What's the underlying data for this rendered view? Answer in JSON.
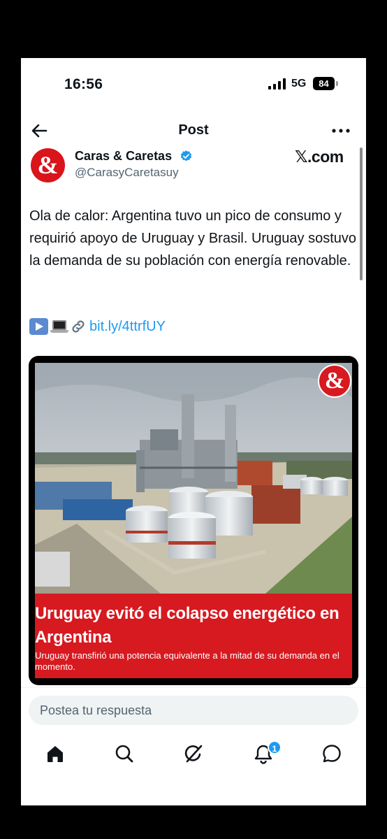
{
  "status_bar": {
    "time": "16:56",
    "network": "5G",
    "battery": "84"
  },
  "header": {
    "title": "Post",
    "back_icon": "arrow-left-icon",
    "more_icon": "more-horizontal-icon"
  },
  "author": {
    "name": "Caras & Caretas",
    "handle": "@CarasyCaretasuy",
    "avatar_text": "&",
    "verified": true
  },
  "watermark": "𝕏.com",
  "tweet": {
    "text": "Ola de calor: Argentina tuvo un pico de consumo y requirió apoyo de Uruguay y Brasil. Uruguay sostuvo la demanda de su población con energía renovable.",
    "link": "bit.ly/4ttrfUY",
    "link_emojis": [
      "play-button-icon",
      "laptop-icon",
      "link-icon"
    ]
  },
  "card": {
    "headline": "Uruguay evitó el colapso energético en Argentina",
    "subtitle": "Uruguay transfirió una potencia equivalente a la mitad de su demanda en el momento.",
    "badge_text": "&",
    "caption_color": "#d71920"
  },
  "reply": {
    "placeholder": "Postea tu respuesta"
  },
  "nav": {
    "items": [
      "home-icon",
      "search-icon",
      "grok-icon",
      "notifications-icon",
      "messages-icon"
    ],
    "notification_count": "1"
  },
  "colors": {
    "accent": "#1d9bf0",
    "brand_red": "#d71920"
  }
}
